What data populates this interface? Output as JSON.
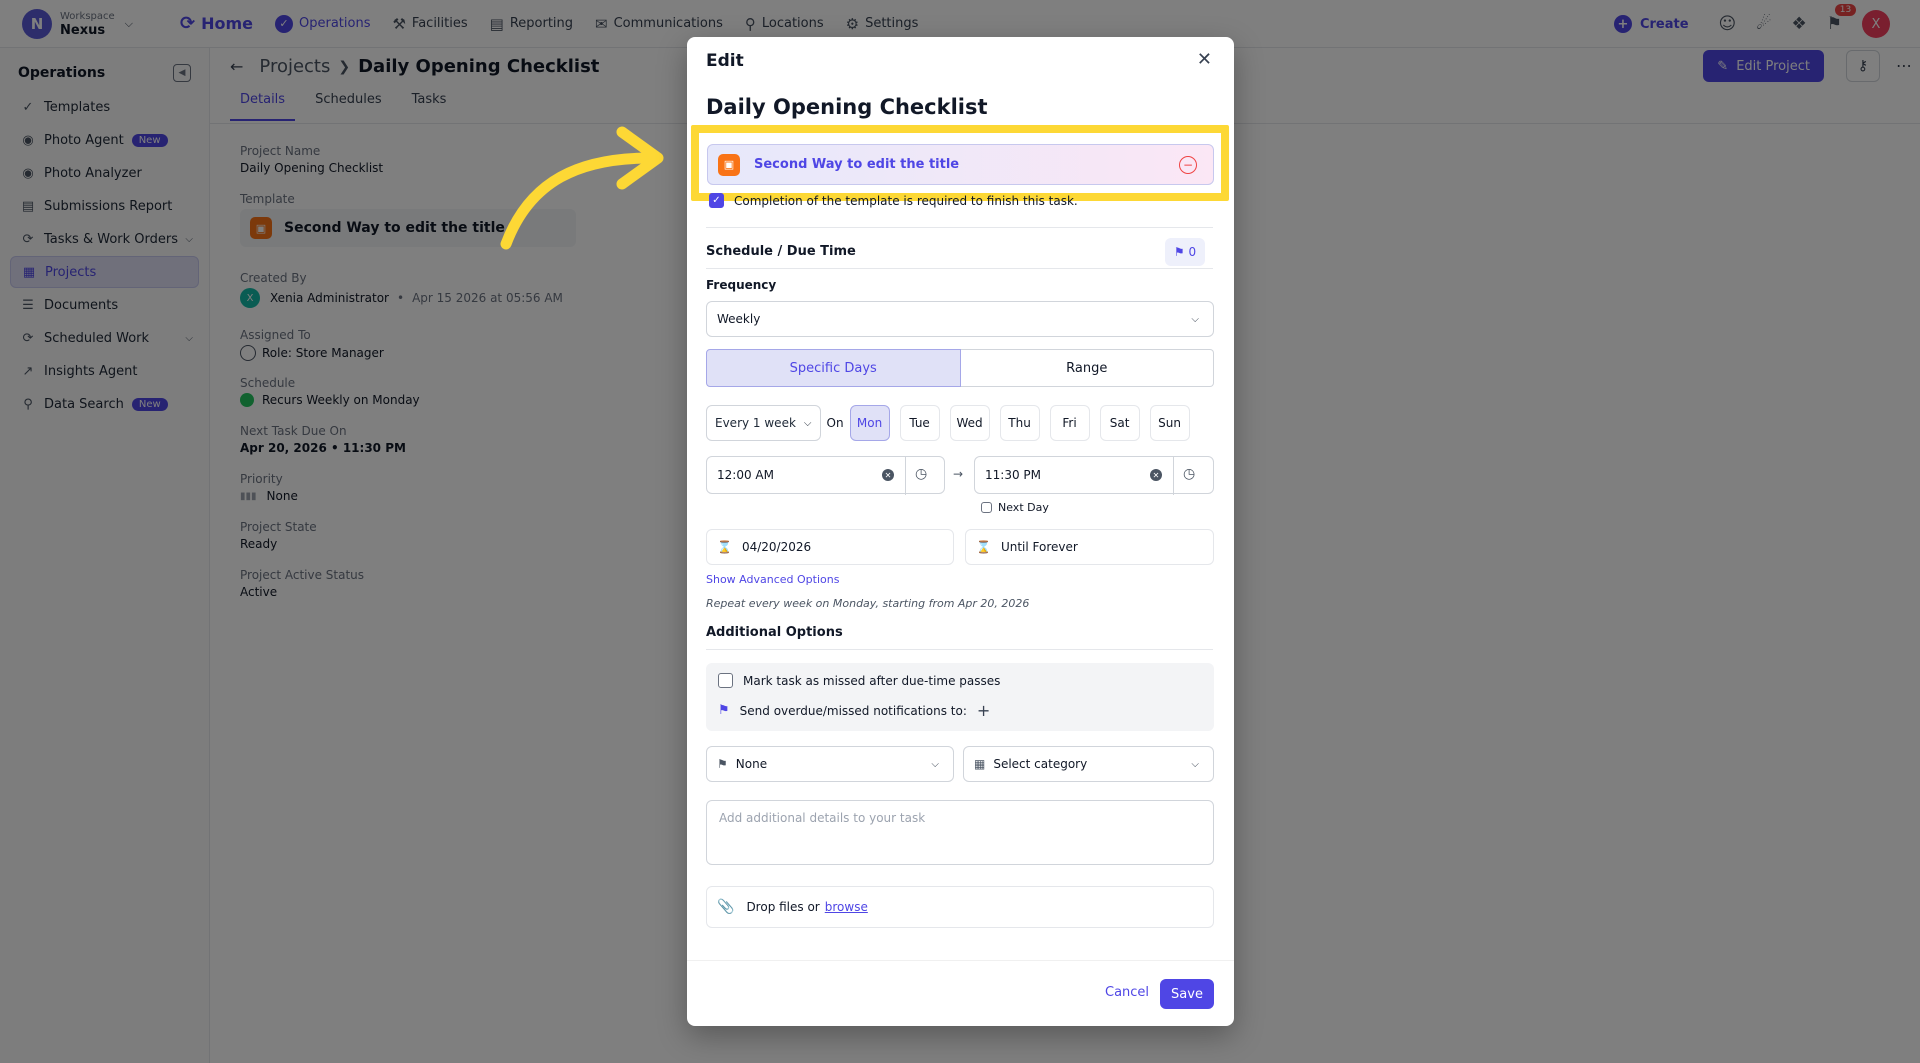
{
  "workspace": {
    "label": "Workspace",
    "name": "Nexus",
    "initial": "N"
  },
  "nav": {
    "home": "Home",
    "items": [
      "Operations",
      "Facilities",
      "Reporting",
      "Communications",
      "Locations",
      "Settings"
    ]
  },
  "topbar": {
    "create_label": "Create",
    "notification_count": "13",
    "user_initial": "X"
  },
  "sidebar": {
    "title": "Operations",
    "items": [
      {
        "label": "Templates"
      },
      {
        "label": "Photo Agent",
        "badge": "New"
      },
      {
        "label": "Photo Analyzer"
      },
      {
        "label": "Submissions Report"
      },
      {
        "label": "Tasks & Work Orders"
      },
      {
        "label": "Projects"
      },
      {
        "label": "Documents"
      },
      {
        "label": "Scheduled Work"
      },
      {
        "label": "Insights Agent"
      },
      {
        "label": "Data Search",
        "badge": "New"
      }
    ]
  },
  "page": {
    "crumb_parent": "Projects",
    "crumb_current": "Daily Opening Checklist",
    "edit_project_label": "Edit Project",
    "tabs": [
      "Details",
      "Schedules",
      "Tasks"
    ],
    "details": {
      "project_name_label": "Project Name",
      "project_name": "Daily Opening Checklist",
      "template_label": "Template",
      "template_name": "Second Way to edit the title",
      "created_by_label": "Created By",
      "created_by_initial": "X",
      "created_by": "Xenia Administrator",
      "created_at": "Apr 15 2026 at 05:56 AM",
      "assigned_to_label": "Assigned To",
      "assigned_to": "Role: Store Manager",
      "schedule_label": "Schedule",
      "schedule": "Recurs Weekly on Monday",
      "next_due_label": "Next Task Due On",
      "next_due": "Apr 20, 2026 • 11:30 PM",
      "priority_label": "Priority",
      "priority": "None",
      "state_label": "Project State",
      "state": "Ready",
      "active_label": "Project Active Status",
      "active": "Active"
    }
  },
  "modal": {
    "title": "Edit",
    "task_title": "Daily Opening Checklist",
    "template_name": "Second Way to edit the title",
    "completion_required": "Completion of the template is required to finish this task.",
    "schedule_section": "Schedule / Due Time",
    "reminder_count": "0",
    "frequency_label": "Frequency",
    "frequency_value": "Weekly",
    "segment": [
      "Specific Days",
      "Range"
    ],
    "every_label": "Every 1 week",
    "on_label": "On",
    "days": [
      "Mon",
      "Tue",
      "Wed",
      "Thu",
      "Fri",
      "Sat",
      "Sun"
    ],
    "selected_day": "Mon",
    "start_time": "12:00 AM",
    "end_time": "11:30 PM",
    "next_day_label": "Next Day",
    "start_date": "04/20/2026",
    "end_date": "Until Forever",
    "advanced_link": "Show Advanced Options",
    "repeat_note": "Repeat every week on Monday, starting from Apr 20, 2026",
    "additional_section": "Additional Options",
    "missed_label": "Mark task as missed after due-time passes",
    "notify_label": "Send overdue/missed notifications to:",
    "priority_value": "None",
    "category_placeholder": "Select category",
    "details_placeholder": "Add additional details to your task",
    "drop_text": "Drop files or",
    "browse_label": "browse",
    "cancel_label": "Cancel",
    "save_label": "Save"
  },
  "colors": {
    "accent": "#4f46e5",
    "highlight": "#fdd835",
    "template_icon": "#f97316"
  }
}
